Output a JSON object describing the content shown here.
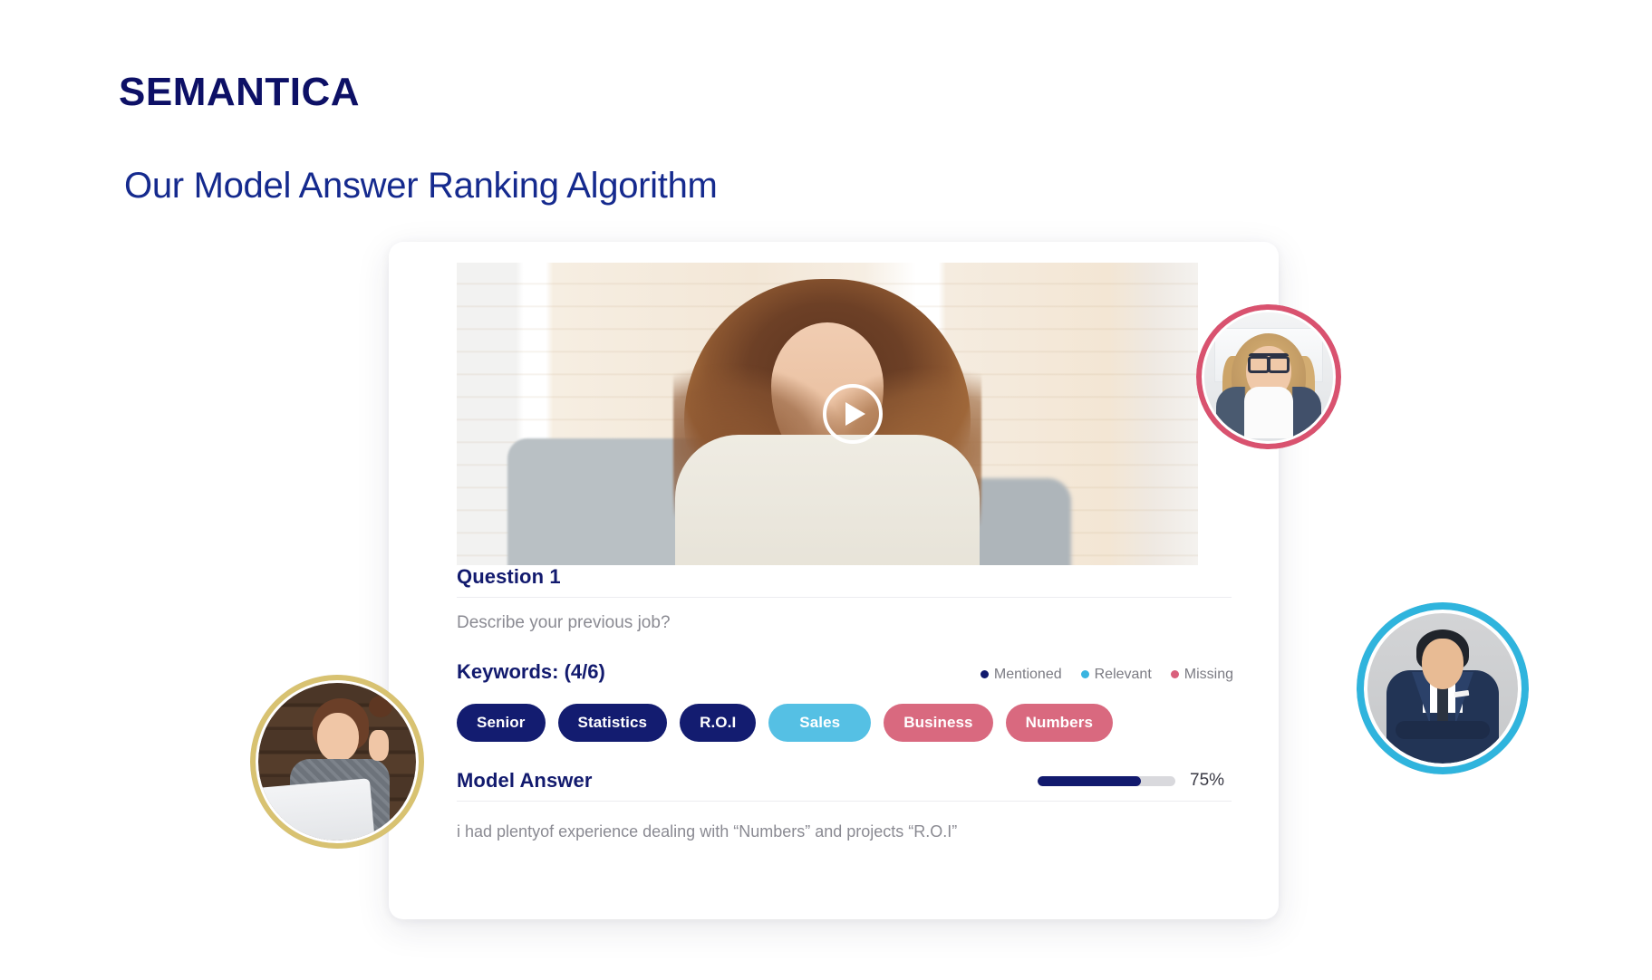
{
  "brand": {
    "name": "SEMANTICA"
  },
  "header": {
    "title": "Our Model Answer Ranking Algorithm"
  },
  "card": {
    "video": {
      "play_label": "Play",
      "alt": "Interview video thumbnail — smiling woman with curly hair wearing earbuds"
    },
    "question": {
      "heading": "Question 1",
      "text": "Describe your previous job?"
    },
    "keywords": {
      "heading": "Keywords: (4/6)",
      "matched": 4,
      "total": 6,
      "legend": [
        {
          "label": "Mentioned",
          "color": "#111a6e"
        },
        {
          "label": "Relevant",
          "color": "#39b4e0"
        },
        {
          "label": "Missing",
          "color": "#d9607c"
        }
      ],
      "items": [
        {
          "label": "Senior",
          "status": "Mentioned",
          "color": "#131c70"
        },
        {
          "label": "Statistics",
          "status": "Mentioned",
          "color": "#131c70"
        },
        {
          "label": "R.O.I",
          "status": "Mentioned",
          "color": "#131c70"
        },
        {
          "label": "Sales",
          "status": "Relevant",
          "color": "#55c0e4"
        },
        {
          "label": "Business",
          "status": "Missing",
          "color": "#d9697f"
        },
        {
          "label": "Numbers",
          "status": "Missing",
          "color": "#d9697f"
        }
      ]
    },
    "model_answer": {
      "heading": "Model Answer",
      "score_label": "75%",
      "score_value": 75,
      "text": "i had plentyof experience dealing with “Numbers” and projects “R.O.I”"
    }
  },
  "avatars": [
    {
      "name": "woman-with-glasses",
      "ring_color": "#d9526f"
    },
    {
      "name": "man-in-suit",
      "ring_color": "#2fb4dd"
    },
    {
      "name": "woman-at-laptop",
      "ring_color": "#d8c271"
    }
  ],
  "colors": {
    "navy": "#131c70",
    "title_blue": "#152a8e",
    "cyan": "#55c0e4",
    "pink": "#d9697f",
    "muted_text": "#8a8a92",
    "track": "#d9d9dd"
  }
}
